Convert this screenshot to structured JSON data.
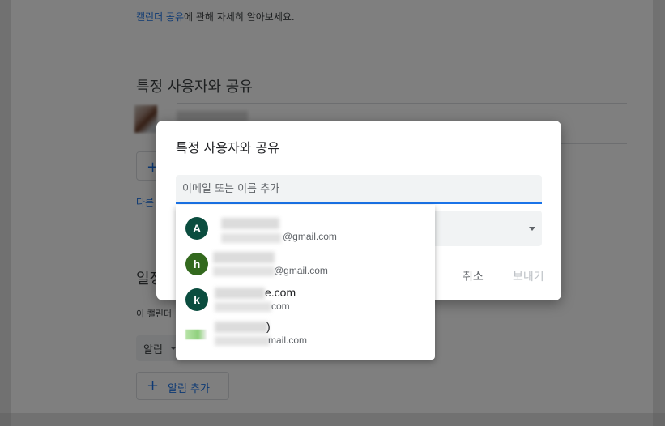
{
  "background": {
    "learn_more_link": "캘린더 공유",
    "learn_more_rest": "에 관해 자세히 알아보세요.",
    "share_section_title": "특정 사용자와 공유",
    "add_user_icon": "plus-icon",
    "other_link": "다른",
    "notif_section_title": "일정",
    "notif_desc": "이 캘린더",
    "alarm_select_value": "알림",
    "add_alarm_label": "알림 추가"
  },
  "dialog": {
    "title": "특정 사용자와 공유",
    "email_placeholder": "이메일 또는 이름 추가",
    "email_value": "",
    "cancel_label": "취소",
    "send_label": "보내기"
  },
  "suggestions": [
    {
      "avatar_letter": "A",
      "avatar_color": "#0b4d3f",
      "name_visible": "",
      "email_visible": "@gmail.com"
    },
    {
      "avatar_letter": "h",
      "avatar_color": "#33691e",
      "name_visible": "",
      "email_visible": "@gmail.com"
    },
    {
      "avatar_letter": "k",
      "avatar_color": "#0b4d3f",
      "name_visible": "e.com",
      "email_visible": "com"
    },
    {
      "avatar_letter": "",
      "avatar_color": "",
      "name_visible": ")",
      "email_visible": "mail.com"
    }
  ],
  "colors": {
    "accent": "#1a73e8",
    "input_bg": "#f1f3f4",
    "divider": "#dadce0"
  }
}
